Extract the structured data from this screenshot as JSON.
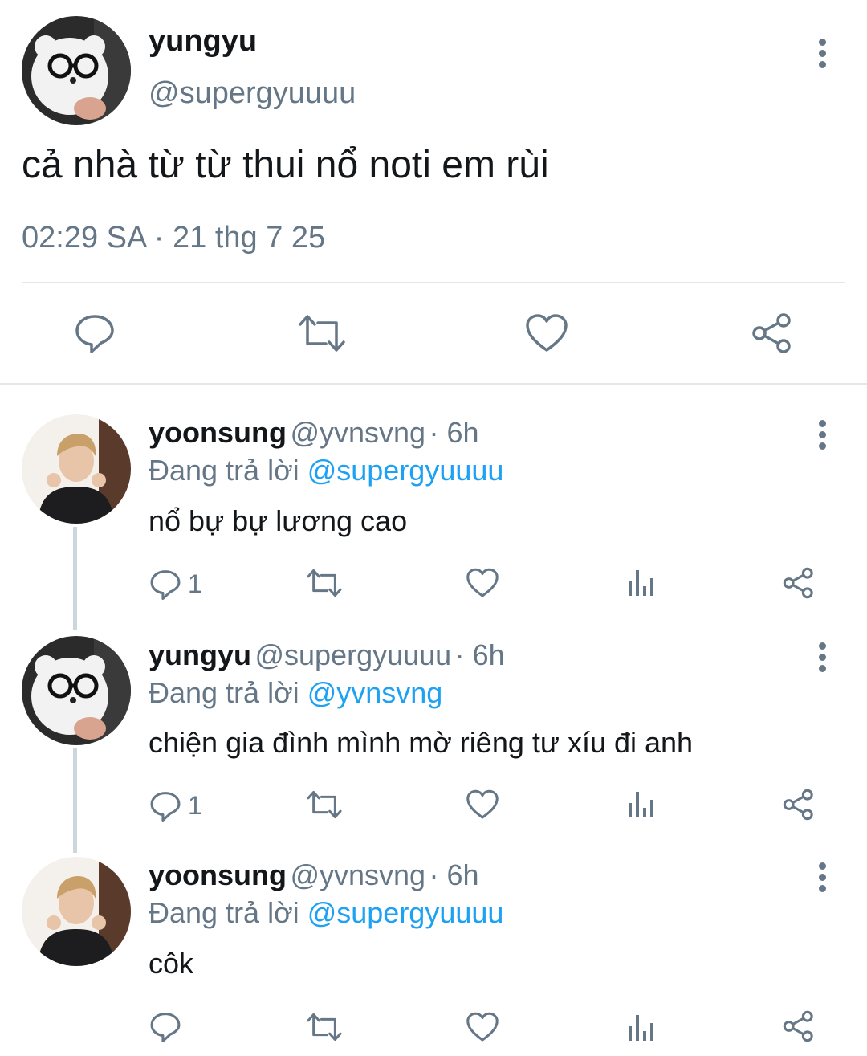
{
  "main_tweet": {
    "display_name": "yungyu",
    "handle": "@supergyuuuu",
    "text": "cả nhà từ từ thui nổ noti em rùi",
    "timestamp": "02:29 SA · 21 thg 7 25",
    "avatar_icon": "bear-plush-avatar",
    "actions": [
      "reply-icon",
      "retweet-icon",
      "like-icon",
      "share-icon"
    ]
  },
  "replies": [
    {
      "display_name": "yoonsung",
      "handle": "@yvnsvng",
      "time": "· 6h",
      "replying_prefix": "Đang trả lời",
      "replying_to": "@supergyuuuu",
      "text": "nổ bự bự lương cao",
      "reply_count": "1"
    },
    {
      "display_name": "yungyu",
      "handle": "@supergyuuuu",
      "time": "· 6h",
      "replying_prefix": "Đang trả lời",
      "replying_to": "@yvnsvng",
      "text": "chiện gia đình mình mờ riêng tư xíu đi anh",
      "reply_count": "1"
    },
    {
      "display_name": "yoonsung",
      "handle": "@yvnsvng",
      "time": "· 6h",
      "replying_prefix": "Đang trả lời",
      "replying_to": "@supergyuuuu",
      "text": "côk",
      "reply_count": ""
    }
  ],
  "colors": {
    "text_primary": "#14171a",
    "text_secondary": "#657786",
    "link": "#1da1f2",
    "divider": "#e1e8ed"
  }
}
